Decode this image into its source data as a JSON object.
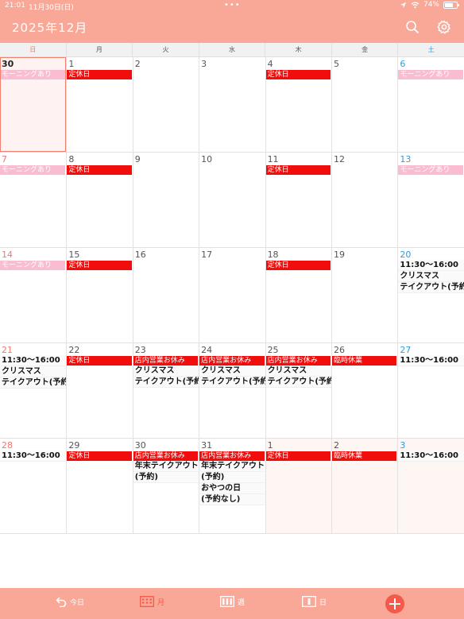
{
  "status_bar": {
    "time": "21:01",
    "date": "11月30日(日)",
    "dots": "•••",
    "battery": "74%",
    "battery_level": 0.74
  },
  "header": {
    "title": "2025年12月"
  },
  "weekdays": [
    "日",
    "月",
    "火",
    "水",
    "木",
    "金",
    "土"
  ],
  "weeks": [
    [
      {
        "day": "30",
        "today": true,
        "events": [
          {
            "text": "モーニングあり",
            "style": "pink"
          }
        ]
      },
      {
        "day": "1",
        "events": [
          {
            "text": "定休日",
            "style": "red"
          }
        ]
      },
      {
        "day": "2",
        "events": []
      },
      {
        "day": "3",
        "events": []
      },
      {
        "day": "4",
        "events": [
          {
            "text": "定休日",
            "style": "red"
          }
        ]
      },
      {
        "day": "5",
        "events": []
      },
      {
        "day": "6",
        "events": [
          {
            "text": "モーニングあり",
            "style": "pink"
          }
        ]
      }
    ],
    [
      {
        "day": "7",
        "events": [
          {
            "text": "モーニングあり",
            "style": "pink"
          }
        ]
      },
      {
        "day": "8",
        "events": [
          {
            "text": "定休日",
            "style": "red"
          }
        ]
      },
      {
        "day": "9",
        "events": []
      },
      {
        "day": "10",
        "events": []
      },
      {
        "day": "11",
        "events": [
          {
            "text": "定休日",
            "style": "red"
          }
        ]
      },
      {
        "day": "12",
        "events": []
      },
      {
        "day": "13",
        "events": [
          {
            "text": "モーニングあり",
            "style": "pink"
          }
        ]
      }
    ],
    [
      {
        "day": "14",
        "events": [
          {
            "text": "モーニングあり",
            "style": "pink"
          }
        ]
      },
      {
        "day": "15",
        "events": [
          {
            "text": "定休日",
            "style": "red"
          }
        ]
      },
      {
        "day": "16",
        "events": []
      },
      {
        "day": "17",
        "events": []
      },
      {
        "day": "18",
        "events": [
          {
            "text": "定休日",
            "style": "red"
          }
        ]
      },
      {
        "day": "19",
        "events": []
      },
      {
        "day": "20",
        "events": [
          {
            "text": "11:30〜16:00",
            "style": "txt"
          },
          {
            "text": "クリスマス",
            "style": "txt"
          },
          {
            "text": "テイクアウト(予約",
            "style": "txt"
          }
        ]
      }
    ],
    [
      {
        "day": "21",
        "events": [
          {
            "text": "11:30〜16:00",
            "style": "txt"
          },
          {
            "text": "クリスマス",
            "style": "txt"
          },
          {
            "text": "テイクアウト(予約",
            "style": "txt"
          }
        ]
      },
      {
        "day": "22",
        "events": [
          {
            "text": "定休日",
            "style": "red"
          }
        ]
      },
      {
        "day": "23",
        "events": [
          {
            "text": "店内営業お休み",
            "style": "red"
          },
          {
            "text": "クリスマス",
            "style": "txt"
          },
          {
            "text": "テイクアウト(予約",
            "style": "txt"
          }
        ]
      },
      {
        "day": "24",
        "events": [
          {
            "text": "店内営業お休み",
            "style": "red"
          },
          {
            "text": "クリスマス",
            "style": "txt"
          },
          {
            "text": "テイクアウト(予約",
            "style": "txt"
          }
        ]
      },
      {
        "day": "25",
        "events": [
          {
            "text": "店内営業お休み",
            "style": "red"
          },
          {
            "text": "クリスマス",
            "style": "txt"
          },
          {
            "text": "テイクアウト(予約",
            "style": "txt"
          }
        ]
      },
      {
        "day": "26",
        "events": [
          {
            "text": "臨時休業",
            "style": "red"
          }
        ]
      },
      {
        "day": "27",
        "events": [
          {
            "text": "11:30〜16:00",
            "style": "txt"
          }
        ]
      }
    ],
    [
      {
        "day": "28",
        "events": [
          {
            "text": "11:30〜16:00",
            "style": "txt"
          }
        ]
      },
      {
        "day": "29",
        "events": [
          {
            "text": "定休日",
            "style": "red"
          }
        ]
      },
      {
        "day": "30",
        "events": [
          {
            "text": "店内営業お休み",
            "style": "red"
          },
          {
            "text": "年末テイクアウト",
            "style": "txt"
          },
          {
            "text": "(予約)",
            "style": "txt"
          }
        ]
      },
      {
        "day": "31",
        "events": [
          {
            "text": "店内営業お休み",
            "style": "red"
          },
          {
            "text": "年末テイクアウト",
            "style": "txt"
          },
          {
            "text": "(予約)",
            "style": "txt"
          },
          {
            "text": "おやつの日",
            "style": "txt"
          },
          {
            "text": "(予約なし)",
            "style": "txt"
          }
        ]
      },
      {
        "day": "1",
        "other": true,
        "events": [
          {
            "text": "定休日",
            "style": "red"
          }
        ]
      },
      {
        "day": "2",
        "other": true,
        "events": [
          {
            "text": "臨時休業",
            "style": "red"
          }
        ]
      },
      {
        "day": "3",
        "other": true,
        "events": [
          {
            "text": "11:30〜16:00",
            "style": "txt"
          }
        ]
      }
    ]
  ],
  "bottom_bar": {
    "today_label": "今日",
    "month_label": "月",
    "week_label": "週",
    "day_label": "日"
  },
  "colors": {
    "header_bg": "#f9a898",
    "closed_red": "#f20d0d",
    "morning_pink": "#f9bcd0",
    "sunday": "#f07870",
    "saturday": "#2b9de0",
    "accent": "#f35a4a"
  }
}
